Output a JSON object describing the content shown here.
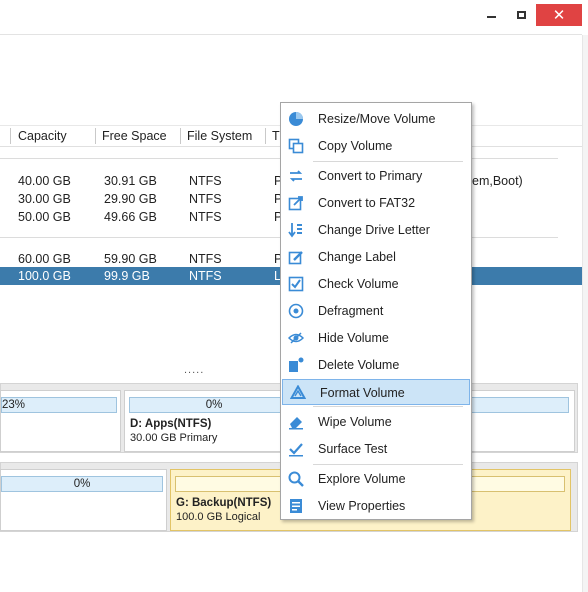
{
  "window": {
    "minimize_glyph": "",
    "close_glyph": "✕"
  },
  "table": {
    "headers": [
      "Capacity",
      "Free Space",
      "File System",
      "T"
    ],
    "rows": [
      {
        "capacity": "40.00 GB",
        "free": "30.91 GB",
        "fs": "NTFS",
        "type": "P",
        "status": "em,Boot)"
      },
      {
        "capacity": "30.00 GB",
        "free": "29.90 GB",
        "fs": "NTFS",
        "type": "P"
      },
      {
        "capacity": "50.00 GB",
        "free": "49.66 GB",
        "fs": "NTFS",
        "type": "P"
      },
      {
        "capacity": "60.00 GB",
        "free": "59.90 GB",
        "fs": "NTFS",
        "type": "P"
      },
      {
        "capacity": "100.0 GB",
        "free": "99.9 GB",
        "fs": "NTFS",
        "type": "L"
      }
    ],
    "more": "....."
  },
  "diskmap": {
    "disk1": {
      "p0_bar": "23%",
      "p1_bar": "0%",
      "p1_name": "D: Apps(NTFS)",
      "p1_info": "30.00 GB Primary"
    },
    "disk2": {
      "p0_bar": "0%",
      "p1_name": "G: Backup(NTFS)",
      "p1_info": "100.0 GB Logical"
    }
  },
  "menu": {
    "items": [
      {
        "label": "Resize/Move Volume",
        "icon": "pie-icon"
      },
      {
        "label": "Copy Volume",
        "icon": "copy-icon"
      },
      {
        "label": "Convert to Primary",
        "icon": "convert-icon"
      },
      {
        "label": "Convert to FAT32",
        "icon": "convert-fat-icon"
      },
      {
        "label": "Change Drive Letter",
        "icon": "drive-letter-icon"
      },
      {
        "label": "Change Label",
        "icon": "label-edit-icon"
      },
      {
        "label": "Check Volume",
        "icon": "check-volume-icon"
      },
      {
        "label": "Defragment",
        "icon": "defrag-icon"
      },
      {
        "label": "Hide Volume",
        "icon": "hide-eye-icon"
      },
      {
        "label": "Delete Volume",
        "icon": "delete-volume-icon"
      },
      {
        "label": "Format Volume",
        "icon": "recycle-icon"
      },
      {
        "label": "Wipe Volume",
        "icon": "eraser-icon"
      },
      {
        "label": "Surface Test",
        "icon": "surface-test-icon"
      },
      {
        "label": "Explore Volume",
        "icon": "search-icon"
      },
      {
        "label": "View Properties",
        "icon": "properties-icon"
      }
    ],
    "highlighted_index": 10
  },
  "colors": {
    "accent": "#3c7bab",
    "icon_blue": "#3a8bd6",
    "close_red": "#e04343",
    "menu_highlight": "#cce4f7"
  }
}
